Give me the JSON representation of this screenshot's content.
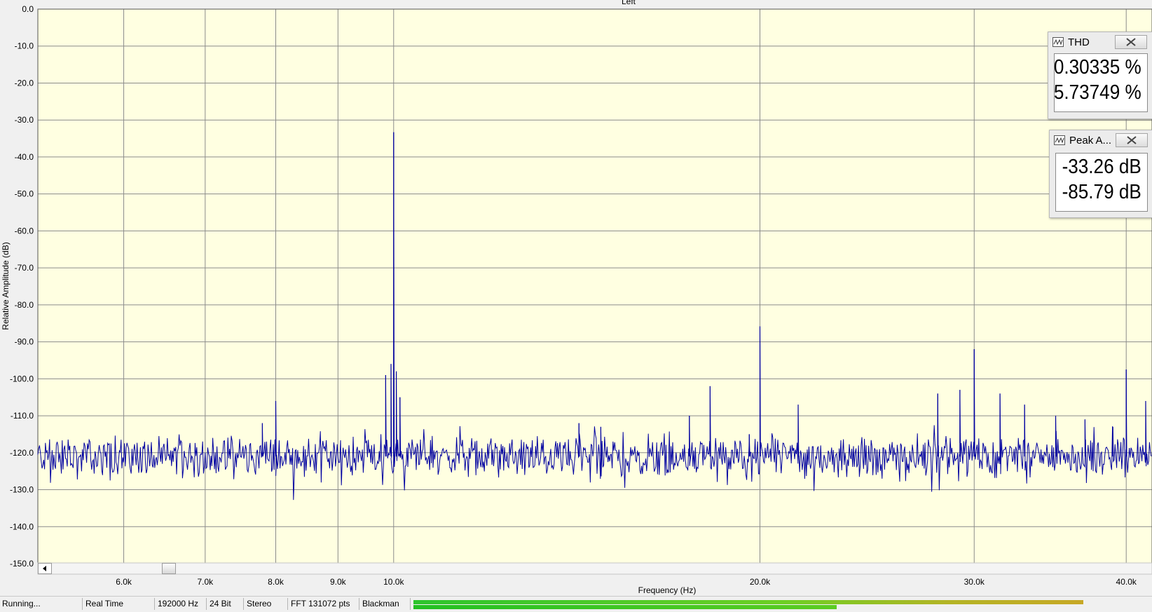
{
  "chart_data": {
    "type": "line",
    "title": "Left",
    "xlabel": "Frequency (Hz)",
    "ylabel": "Relative Amplitude (dB)",
    "x_scale": "log",
    "xlim": [
      5100,
      42000
    ],
    "ylim": [
      -150,
      0
    ],
    "grid": true,
    "y_ticks": [
      0,
      -10,
      -20,
      -30,
      -40,
      -50,
      -60,
      -70,
      -80,
      -90,
      -100,
      -110,
      -120,
      -130,
      -140,
      -150
    ],
    "y_tick_labels": [
      "0.0",
      "-10.0",
      "-20.0",
      "-30.0",
      "-40.0",
      "-50.0",
      "-60.0",
      "-70.0",
      "-80.0",
      "-90.0",
      "-100.0",
      "-110.0",
      "-120.0",
      "-130.0",
      "-140.0",
      "-150.0"
    ],
    "x_ticks": [
      6000,
      7000,
      8000,
      9000,
      10000,
      20000,
      30000,
      40000
    ],
    "x_tick_labels": [
      "6.0k",
      "7.0k",
      "8.0k",
      "9.0k",
      "10.0k",
      "20.0k",
      "30.0k",
      "40.0k"
    ],
    "noise_floor_db": -121,
    "peaks": [
      {
        "x": 7800,
        "y": -112
      },
      {
        "x": 8000,
        "y": -106
      },
      {
        "x": 9850,
        "y": -99
      },
      {
        "x": 9950,
        "y": -96
      },
      {
        "x": 10000,
        "y": -33.3
      },
      {
        "x": 10050,
        "y": -98
      },
      {
        "x": 10120,
        "y": -105
      },
      {
        "x": 14200,
        "y": -112
      },
      {
        "x": 14800,
        "y": -113
      },
      {
        "x": 17500,
        "y": -110
      },
      {
        "x": 18200,
        "y": -102
      },
      {
        "x": 19600,
        "y": -115
      },
      {
        "x": 20000,
        "y": -85.8
      },
      {
        "x": 21500,
        "y": -107
      },
      {
        "x": 28000,
        "y": -104
      },
      {
        "x": 29200,
        "y": -103
      },
      {
        "x": 30000,
        "y": -92
      },
      {
        "x": 31500,
        "y": -104
      },
      {
        "x": 33000,
        "y": -107
      },
      {
        "x": 35000,
        "y": -110
      },
      {
        "x": 37000,
        "y": -111
      },
      {
        "x": 39000,
        "y": -113
      },
      {
        "x": 40000,
        "y": -97.5
      },
      {
        "x": 41500,
        "y": -106
      }
    ],
    "series": [
      {
        "color": "#0000a0"
      }
    ]
  },
  "readouts": {
    "thd": {
      "label": "THD",
      "values": [
        "0.30335 %",
        "5.73749 %"
      ]
    },
    "peak": {
      "label": "Peak A...",
      "values": [
        "-33.26 dB",
        "-85.79 dB"
      ]
    }
  },
  "status": {
    "state": "Running...",
    "mode": "Real Time",
    "sample_rate": "192000 Hz",
    "bit_depth": "24 Bit",
    "channels": "Stereo",
    "fft": "FFT 131072 pts",
    "window": "Blackman",
    "meter_left": 0.95,
    "meter_right": 0.6
  },
  "colors": {
    "plot_background": "#ffffe1",
    "grid": "#8c8c8c",
    "trace": "#0000a0"
  }
}
